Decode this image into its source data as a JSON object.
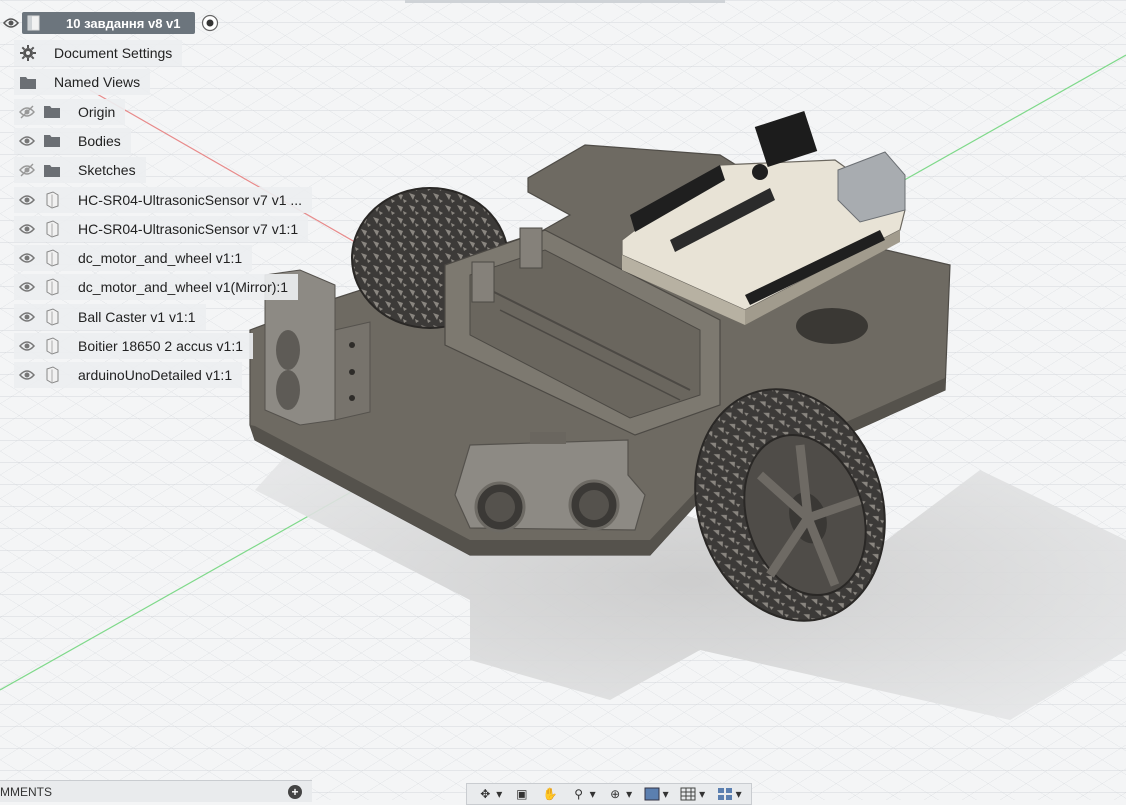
{
  "browser": {
    "root": {
      "label": "10 завдання v8 v1"
    },
    "items": [
      {
        "label": "Document Settings",
        "icon": "gear-icon",
        "eye": "none"
      },
      {
        "label": "Named Views",
        "icon": "folder-icon",
        "eye": "none"
      },
      {
        "label": "Origin",
        "icon": "folder-icon",
        "eye": "hidden"
      },
      {
        "label": "Bodies",
        "icon": "folder-icon",
        "eye": "visible"
      },
      {
        "label": "Sketches",
        "icon": "folder-icon",
        "eye": "hidden"
      },
      {
        "label": "HC-SR04-UltrasonicSensor v7 v1 ...",
        "icon": "component-icon",
        "eye": "visible"
      },
      {
        "label": "HC-SR04-UltrasonicSensor v7 v1:1",
        "icon": "component-icon",
        "eye": "visible"
      },
      {
        "label": "dc_motor_and_wheel v1:1",
        "icon": "component-icon",
        "eye": "visible"
      },
      {
        "label": "dc_motor_and_wheel v1(Mirror):1",
        "icon": "component-icon",
        "eye": "visible"
      },
      {
        "label": "Ball Caster v1 v1:1",
        "icon": "component-icon",
        "eye": "visible"
      },
      {
        "label": "Boitier 18650 2 accus v1:1",
        "icon": "component-icon",
        "eye": "visible"
      },
      {
        "label": "arduinoUnoDetailed v1:1",
        "icon": "component-icon",
        "eye": "visible"
      }
    ]
  },
  "comments": {
    "label": "MMENTS"
  },
  "navbar": {
    "tools": [
      "orbit-icon",
      "look-at-icon",
      "pan-icon",
      "zoom-window-icon",
      "zoom-icon",
      "display-style-icon",
      "grid-icon",
      "viewports-icon"
    ]
  },
  "colors": {
    "axis_red": "#e88a8a",
    "axis_green": "#7fd98a",
    "grid": "#d5d8dc",
    "body": "#6e6a62"
  }
}
